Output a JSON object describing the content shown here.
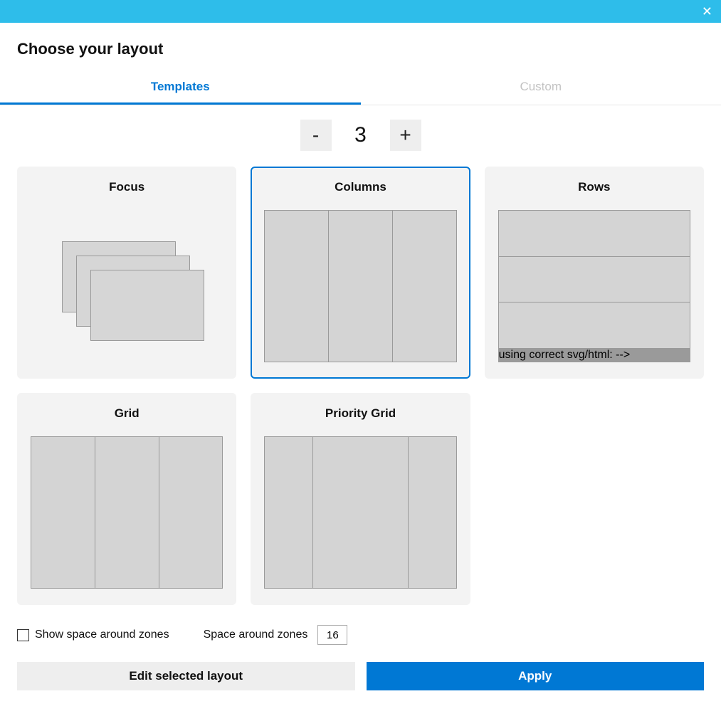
{
  "header": {
    "title": "Choose your layout"
  },
  "tabs": {
    "templates": "Templates",
    "custom": "Custom",
    "active": "templates"
  },
  "stepper": {
    "minus": "-",
    "plus": "+",
    "value": "3"
  },
  "layouts": {
    "focus": "Focus",
    "columns": "Columns",
    "rows": "Rows",
    "grid": "Grid",
    "priority": "Priority Grid",
    "selected": "columns"
  },
  "options": {
    "show_space_label": "Show space around zones",
    "show_space_checked": false,
    "space_label": "Space around zones",
    "space_value": "16"
  },
  "actions": {
    "edit": "Edit selected layout",
    "apply": "Apply"
  }
}
